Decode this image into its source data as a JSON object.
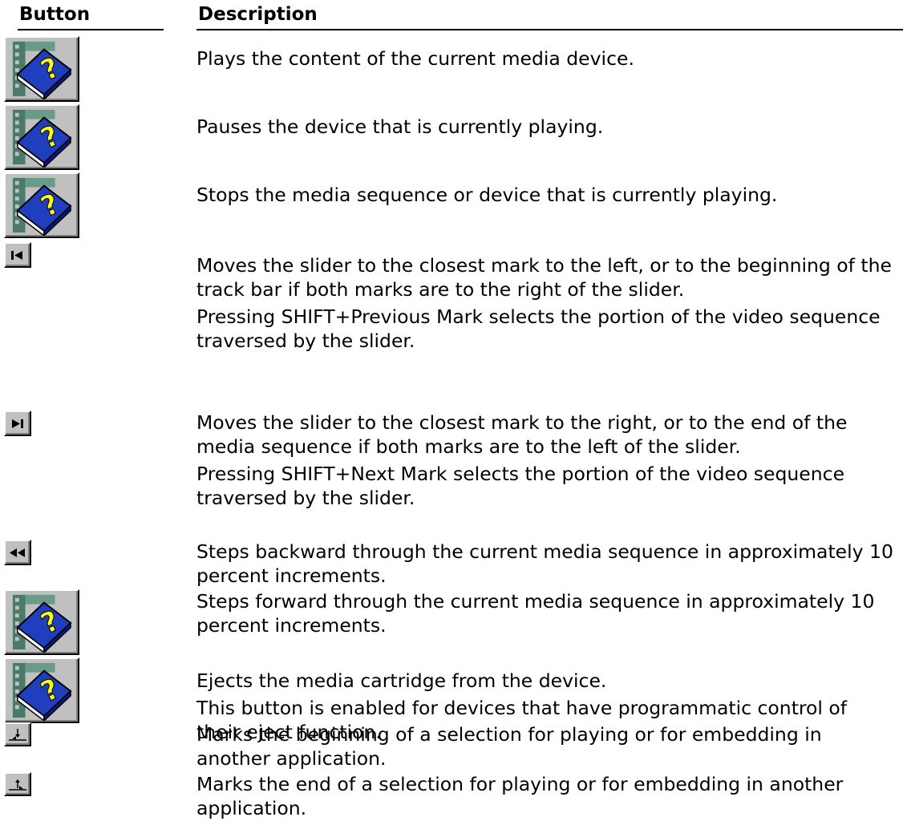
{
  "headers": {
    "button": "Button",
    "description": "Description"
  },
  "rows": [
    {
      "icon": "help-book-icon",
      "text": [
        "Plays the content of the current media device."
      ]
    },
    {
      "icon": "help-book-icon",
      "text": [
        "Pauses the device that is currently playing."
      ]
    },
    {
      "icon": "help-book-icon",
      "text": [
        "Stops the media sequence or device that is currently playing."
      ]
    },
    {
      "icon": "previous-mark-icon",
      "text": [
        "Moves the slider to the closest mark to the left, or to the beginning of the track bar if both marks are to the right of the slider.",
        "Pressing SHIFT+Previous Mark selects the portion of the video sequence traversed by the slider."
      ]
    },
    {
      "icon": "next-mark-icon",
      "text": [
        "Moves the slider to the closest mark to the right, or to the end of the media sequence if both marks are to the left of the slider.",
        "Pressing SHIFT+Next Mark selects the portion of the video sequence traversed by the slider."
      ]
    },
    {
      "icon": "rewind-icon",
      "text": [
        "Steps backward through the current media sequence in approximately 10 percent increments."
      ]
    },
    {
      "icon": "help-book-icon",
      "text": [
        "Steps forward through the current media sequence in approximately 10 percent increments."
      ]
    },
    {
      "icon": "help-book-icon",
      "text": [
        "Ejects the media cartridge from the device.",
        "This button is enabled for devices that have programmatic control of their eject function."
      ]
    },
    {
      "icon": "start-selection-icon",
      "text": [
        "Marks the beginning of a selection for playing or for embedding in another application."
      ]
    },
    {
      "icon": "end-selection-icon",
      "text": [
        "Marks the end of a selection for playing or for embedding in another application."
      ]
    }
  ],
  "colors": {
    "book_blue": "#1f3fbf",
    "book_question": "#ffff00",
    "button_face": "#c0c0c0"
  }
}
